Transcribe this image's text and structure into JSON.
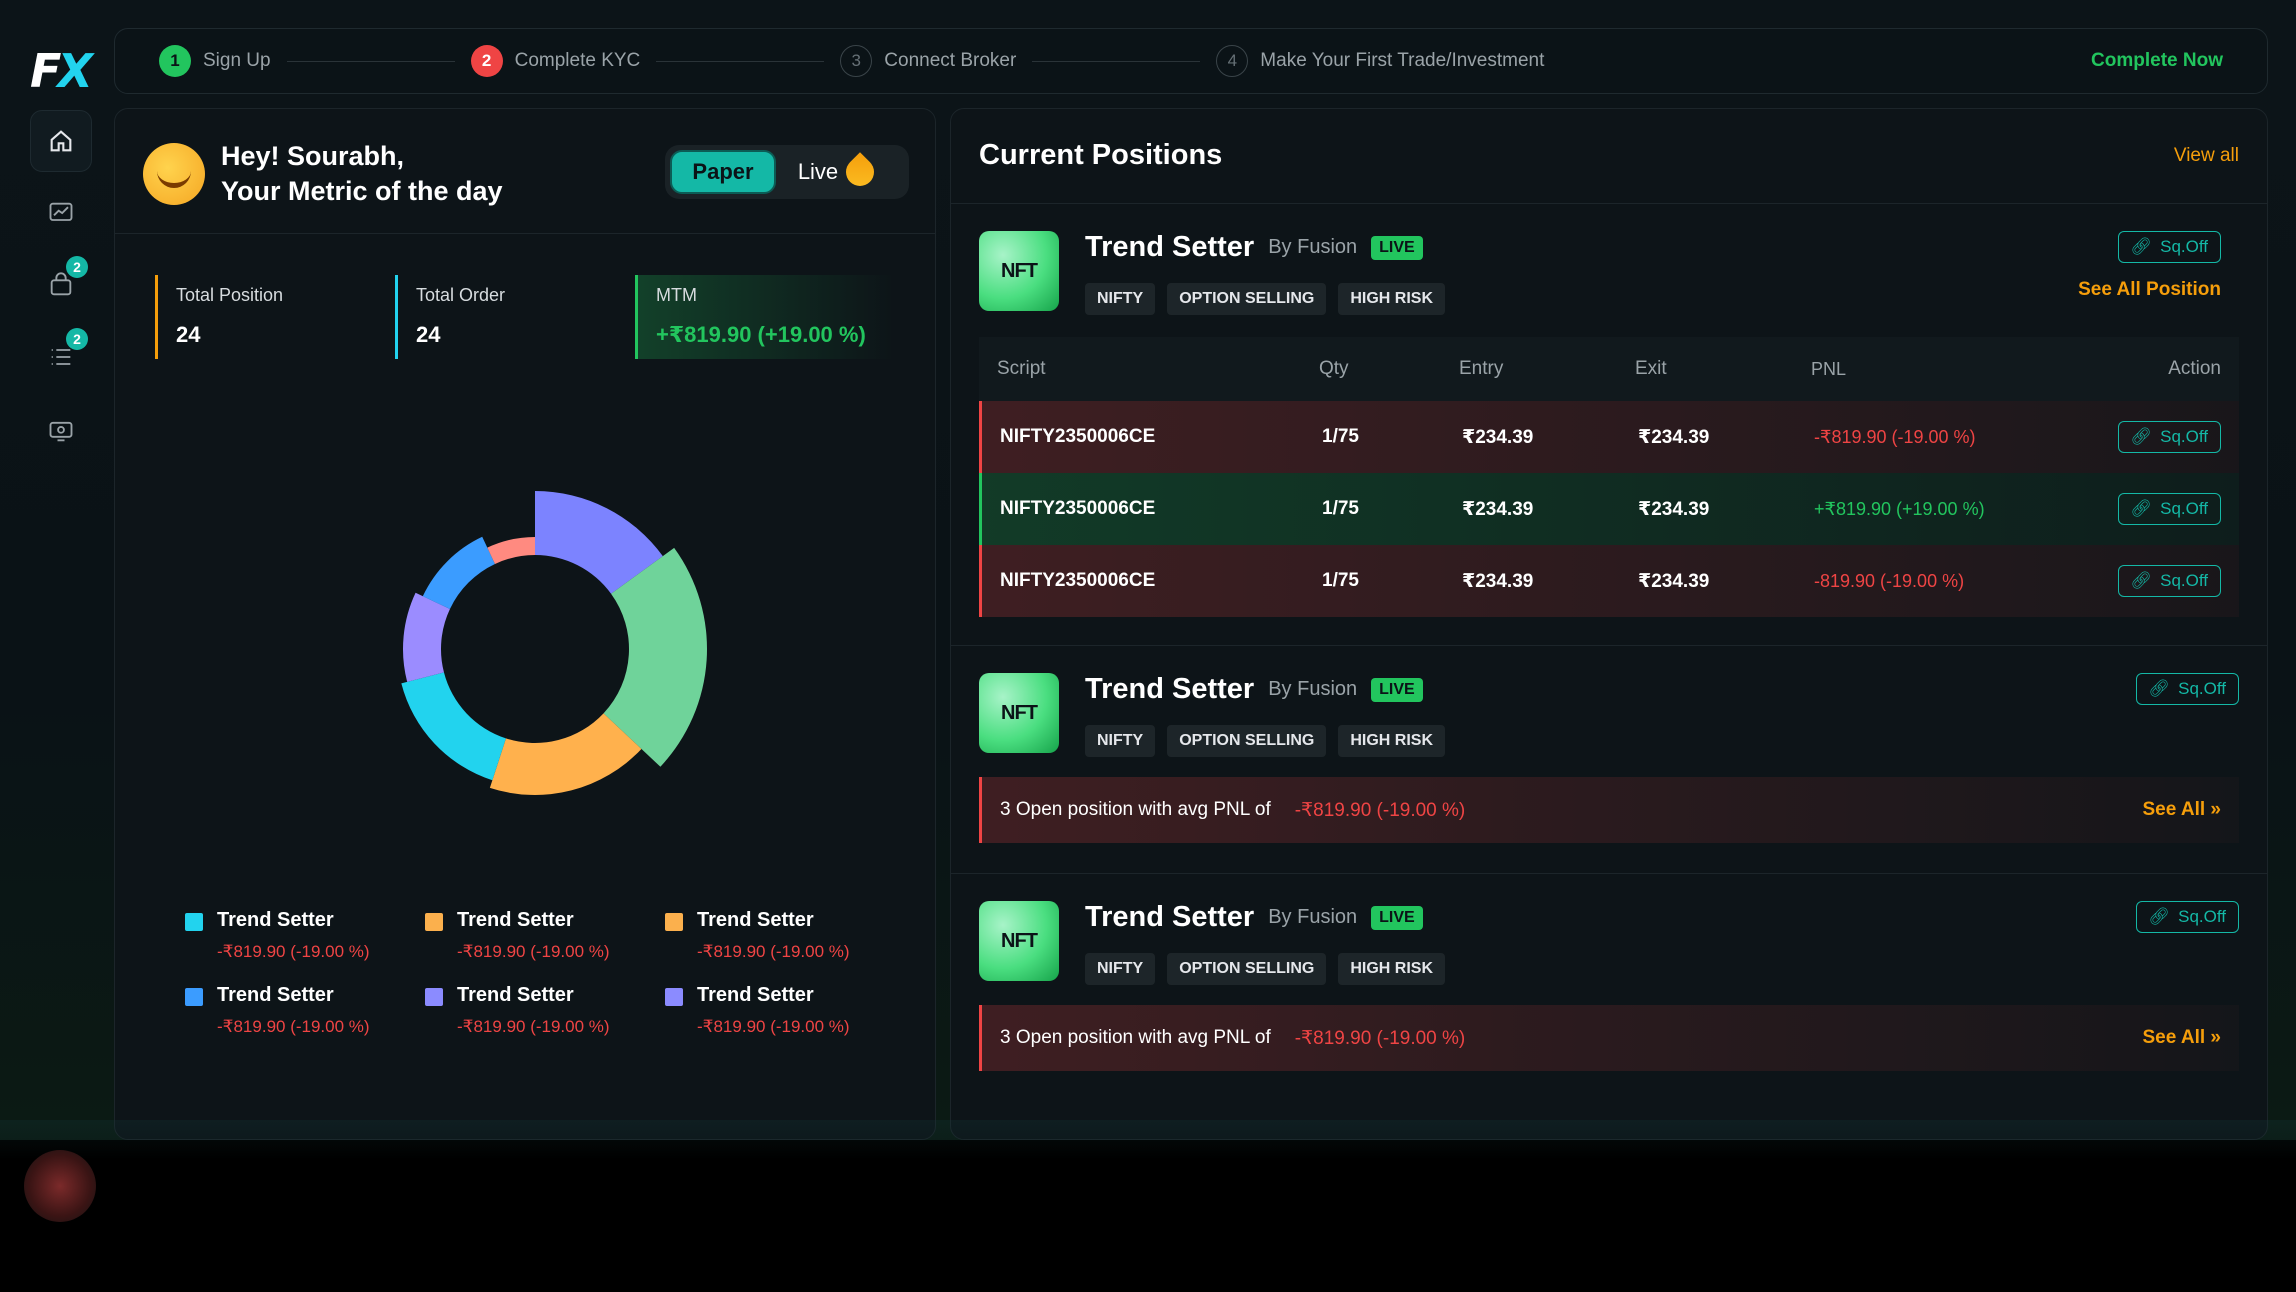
{
  "app": {
    "logo_f": "F",
    "logo_x": "X"
  },
  "stepper": {
    "steps": [
      {
        "num": "1",
        "label": "Sign Up",
        "state": "done"
      },
      {
        "num": "2",
        "label": "Complete KYC",
        "state": "current"
      },
      {
        "num": "3",
        "label": "Connect Broker",
        "state": "pending"
      },
      {
        "num": "4",
        "label": "Make Your First Trade/Investment",
        "state": "pending"
      }
    ],
    "cta": "Complete Now"
  },
  "sidebar": {
    "items": [
      {
        "icon": "home-icon",
        "active": true
      },
      {
        "icon": "chart-icon"
      },
      {
        "icon": "bag-icon",
        "badge": "2"
      },
      {
        "icon": "list-icon",
        "badge": "2"
      },
      {
        "icon": "monitor-icon"
      }
    ]
  },
  "left": {
    "greeting_line1": "Hey! Sourabh,",
    "greeting_line2": "Your Metric of the day",
    "toggle": {
      "paper": "Paper",
      "live": "Live"
    },
    "metrics": [
      {
        "label": "Total Position",
        "value": "24"
      },
      {
        "label": "Total Order",
        "value": "24"
      },
      {
        "label": "MTM",
        "value": "+₹819.90 (+19.00 %)"
      }
    ],
    "legend": [
      {
        "name": "Trend Setter",
        "value": "-₹819.90 (-19.00 %)",
        "color": "#22d3ee"
      },
      {
        "name": "Trend Setter",
        "value": "-₹819.90 (-19.00 %)",
        "color": "#fbb04d"
      },
      {
        "name": "Trend Setter",
        "value": "-₹819.90 (-19.00 %)",
        "color": "#fbb04d"
      },
      {
        "name": "Trend Setter",
        "value": "-₹819.90 (-19.00 %)",
        "color": "#3b9cff"
      },
      {
        "name": "Trend Setter",
        "value": "-₹819.90 (-19.00 %)",
        "color": "#8b8bff"
      },
      {
        "name": "Trend Setter",
        "value": "-₹819.90 (-19.00 %)",
        "color": "#8b8bff"
      }
    ]
  },
  "right": {
    "title": "Current Positions",
    "view_all": "View all",
    "strategies": [
      {
        "logo": "NFT",
        "name": "Trend Setter",
        "by": "By Fusion",
        "badge": "LIVE",
        "tags": [
          "NIFTY",
          "OPTION SELLING",
          "HIGH RISK"
        ],
        "sqoff": "Sq.Off",
        "see_all": "See All Position",
        "columns": [
          "Script",
          "Qty",
          "Entry",
          "Exit",
          "PNL",
          "Action"
        ],
        "rows": [
          {
            "script": "NIFTY2350006CE",
            "qty": "1/75",
            "entry": "₹234.39",
            "exit": "₹234.39",
            "pnl": "-₹819.90 (-19.00 %)",
            "action": "Sq.Off"
          },
          {
            "script": "NIFTY2350006CE",
            "qty": "1/75",
            "entry": "₹234.39",
            "exit": "₹234.39",
            "pnl": "+₹819.90 (+19.00 %)",
            "action": "Sq.Off"
          },
          {
            "script": "NIFTY2350006CE",
            "qty": "1/75",
            "entry": "₹234.39",
            "exit": "₹234.39",
            "pnl": "-819.90 (-19.00 %)",
            "action": "Sq.Off"
          }
        ]
      },
      {
        "logo": "NFT",
        "name": "Trend Setter",
        "by": "By Fusion",
        "badge": "LIVE",
        "tags": [
          "NIFTY",
          "OPTION SELLING",
          "HIGH RISK"
        ],
        "sqoff": "Sq.Off",
        "summary_text": "3 Open position with avg PNL of",
        "summary_pnl": "-₹819.90 (-19.00 %)",
        "summary_see": "See All »"
      },
      {
        "logo": "NFT",
        "name": "Trend Setter",
        "by": "By Fusion",
        "badge": "LIVE",
        "tags": [
          "NIFTY",
          "OPTION SELLING",
          "HIGH RISK"
        ],
        "sqoff": "Sq.Off",
        "summary_text": "3 Open position with avg PNL of",
        "summary_pnl": "-₹819.90 (-19.00 %)",
        "summary_see": "See All »"
      }
    ]
  },
  "chart_data": {
    "type": "pie",
    "style": "donut",
    "slices": [
      {
        "color": "#7c83ff",
        "value": 15
      },
      {
        "color": "#6fd39a",
        "value": 22
      },
      {
        "color": "#ffb14d",
        "value": 18
      },
      {
        "color": "#22d3ee",
        "value": 16
      },
      {
        "color": "#9b8cff",
        "value": 11
      },
      {
        "color": "#3b9cff",
        "value": 11
      },
      {
        "color": "#ff8a80",
        "value": 7
      }
    ]
  }
}
